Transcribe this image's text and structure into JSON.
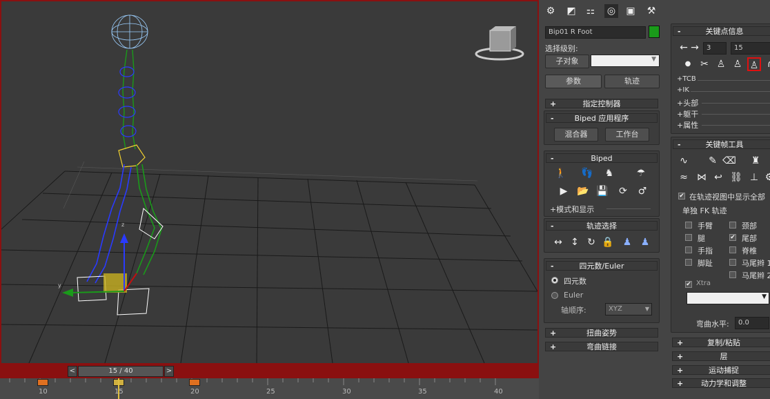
{
  "timeline": {
    "frame_display": "15 / 40",
    "ticks": [
      "10",
      "15",
      "20",
      "25",
      "30",
      "35",
      "40"
    ]
  },
  "cmd_tabs": [
    "gear-icon",
    "curve-icon",
    "hierarchy-icon",
    "motion-icon",
    "display-icon",
    "hammer-icon"
  ],
  "motion": {
    "object_name": "Bip01 R Foot",
    "selection_level": "选择级别:",
    "sub_object": "子对象",
    "params": "参数",
    "trajectory": "轨迹",
    "assign_controller": "指定控制器",
    "biped_apps": "Biped 应用程序",
    "mixer": "混合器",
    "workbench": "工作台",
    "biped": "Biped",
    "mode_display": "+模式和显示",
    "track_selection": "轨迹选择",
    "quat_euler": "四元数/Euler",
    "quaternion": "四元数",
    "euler": "Euler",
    "axis_order_label": "轴顺序:",
    "axis_order": "XYZ",
    "twist_pose": "扭曲姿势",
    "bend_links": "弯曲链接"
  },
  "key_info": {
    "title": "关键点信息",
    "key_num": "3",
    "frame": "15",
    "tcb": "+TCB",
    "ik": "+IK",
    "head": "+头部",
    "body": "+躯干",
    "props": "+属性"
  },
  "keyframe_tools": {
    "title": "关键帧工具",
    "show_all": "在轨迹视图中显示全部",
    "fk_group": "单独 FK 轨迹",
    "arm": "手臂",
    "neck": "颈部",
    "leg": "腿",
    "tail": "尾部",
    "finger": "手指",
    "spine": "脊椎",
    "toe": "脚趾",
    "pony1": "马尾辫 1",
    "pony2": "马尾辫 2",
    "xtra": "Xtra",
    "bend_label": "弯曲水平:",
    "bend_value": "0.0"
  },
  "lower_rollouts": {
    "copy_paste": "复制/粘贴",
    "layers": "层",
    "motion_capture": "运动捕捉",
    "dynamics": "动力学和调整"
  },
  "colors": {
    "accent_red": "#8a1010",
    "swatch_green": "#1a9a1a",
    "highlight_red": "#e01010"
  }
}
